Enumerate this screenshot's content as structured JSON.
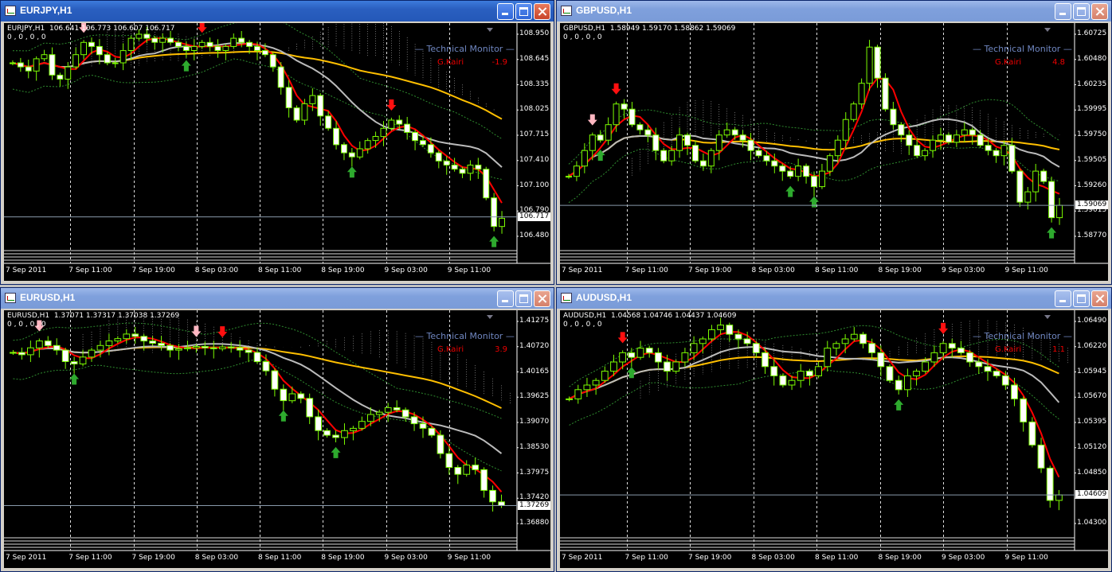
{
  "panels": [
    {
      "title": "EURJPY,H1",
      "header": "EURJPY,H1  106.641 106.773 106.607 106.717",
      "header2": "0 , 0 , 0 , 0",
      "tm_title": "Technical  Monitor",
      "tm_label": "G.Kairi",
      "tm_value": "-1.9",
      "y_ticks": [
        "108.950",
        "108.645",
        "108.335",
        "108.025",
        "107.715",
        "107.410",
        "107.100",
        "106.790",
        "106.480"
      ],
      "price_tag": "106.717",
      "x_ticks": [
        "7 Sep 2011",
        "7 Sep 11:00",
        "7 Sep 19:00",
        "8 Sep 03:00",
        "8 Sep 11:00",
        "8 Sep 19:00",
        "9 Sep 03:00",
        "9 Sep 11:00"
      ]
    },
    {
      "title": "GBPUSD,H1",
      "header": "GBPUSD,H1  1.58949 1.59170 1.58862 1.59069",
      "header2": "0 , 0 , 0 , 0",
      "tm_title": "Technical  Monitor",
      "tm_label": "G.Kairi",
      "tm_value": "4.8",
      "y_ticks": [
        "1.60725",
        "1.60480",
        "1.60235",
        "1.59995",
        "1.59750",
        "1.59505",
        "1.59260",
        "1.59015",
        "1.58770"
      ],
      "price_tag": "1.59069",
      "x_ticks": [
        "7 Sep 2011",
        "7 Sep 11:00",
        "7 Sep 19:00",
        "8 Sep 03:00",
        "8 Sep 11:00",
        "8 Sep 19:00",
        "9 Sep 03:00",
        "9 Sep 11:00"
      ]
    },
    {
      "title": "EURUSD,H1",
      "header": "EURUSD,H1  1.37071 1.37317 1.37038 1.37269",
      "header2": "0 , 0 , 0 , 0",
      "tm_title": "Technical  Monitor",
      "tm_label": "G.Kairi",
      "tm_value": "3.9",
      "y_ticks": [
        "1.41275",
        "1.40720",
        "1.40165",
        "1.39625",
        "1.39070",
        "1.38530",
        "1.37975",
        "1.37420",
        "1.36880"
      ],
      "price_tag": "1.37269",
      "x_ticks": [
        "7 Sep 2011",
        "7 Sep 11:00",
        "7 Sep 19:00",
        "8 Sep 03:00",
        "8 Sep 11:00",
        "8 Sep 19:00",
        "9 Sep 03:00",
        "9 Sep 11:00"
      ]
    },
    {
      "title": "AUDUSD,H1",
      "header": "AUDUSD,H1  1.04568 1.04746 1.04437 1.04609",
      "header2": "0 , 0 , 0 , 0",
      "tm_title": "Technical  Monitor",
      "tm_label": "G.Kairi",
      "tm_value": "1.1",
      "y_ticks": [
        "1.06490",
        "1.06220",
        "1.05945",
        "1.05670",
        "1.05395",
        "1.05120",
        "1.04850",
        "1.04575",
        "1.04300"
      ],
      "price_tag": "1.04609",
      "x_ticks": [
        "7 Sep 2011",
        "7 Sep 11:00",
        "7 Sep 19:00",
        "8 Sep 03:00",
        "8 Sep 11:00",
        "8 Sep 19:00",
        "9 Sep 03:00",
        "9 Sep 11:00"
      ]
    }
  ],
  "colors": {
    "bull": "#7CFC00",
    "bear": "#ffffff",
    "ma_fast": "#ff0000",
    "ma_mid": "#bbbbbb",
    "ma_slow": "#ffbf00",
    "bands": "#2e8b2e",
    "cloud": "#bbbbbb",
    "arrow_up": "#2eaa2e",
    "arrow_down_light": "#ffb6c1",
    "arrow_down_strong": "#ff1010"
  },
  "chart_data": [
    {
      "type": "candlestick",
      "symbol": "EURJPY",
      "timeframe": "H1",
      "ylim": [
        106.48,
        108.95
      ],
      "last": 106.717,
      "closes": [
        108.6,
        108.55,
        108.5,
        108.65,
        108.7,
        108.45,
        108.4,
        108.55,
        108.7,
        108.85,
        108.8,
        108.7,
        108.6,
        108.6,
        108.75,
        108.9,
        108.95,
        108.9,
        108.85,
        108.9,
        108.85,
        108.8,
        108.75,
        108.8,
        108.85,
        108.8,
        108.75,
        108.8,
        108.9,
        108.85,
        108.8,
        108.75,
        108.7,
        108.55,
        108.3,
        108.05,
        107.9,
        108.1,
        108.2,
        107.95,
        107.8,
        107.6,
        107.5,
        107.45,
        107.55,
        107.65,
        107.7,
        107.8,
        107.9,
        107.85,
        107.75,
        107.65,
        107.6,
        107.5,
        107.4,
        107.35,
        107.3,
        107.25,
        107.35,
        107.3,
        106.95,
        106.6,
        106.7
      ]
    },
    {
      "type": "candlestick",
      "symbol": "GBPUSD",
      "timeframe": "H1",
      "ylim": [
        1.5877,
        1.60725
      ],
      "last": 1.59069,
      "closes": [
        1.5935,
        1.5945,
        1.596,
        1.5975,
        1.597,
        1.5985,
        1.6005,
        1.6,
        1.5985,
        1.598,
        1.5975,
        1.596,
        1.595,
        1.596,
        1.5975,
        1.5965,
        1.595,
        1.5945,
        1.596,
        1.5975,
        1.598,
        1.5975,
        1.597,
        1.596,
        1.5955,
        1.595,
        1.5945,
        1.594,
        1.5935,
        1.5945,
        1.5935,
        1.5925,
        1.594,
        1.5955,
        1.597,
        1.599,
        1.6005,
        1.6025,
        1.606,
        1.603,
        1.6,
        1.5985,
        1.5975,
        1.5965,
        1.5955,
        1.596,
        1.597,
        1.5975,
        1.5968,
        1.5975,
        1.598,
        1.5975,
        1.5965,
        1.596,
        1.5955,
        1.5965,
        1.594,
        1.591,
        1.592,
        1.594,
        1.593,
        1.5895,
        1.5907
      ]
    },
    {
      "type": "candlestick",
      "symbol": "EURUSD",
      "timeframe": "H1",
      "ylim": [
        1.3688,
        1.41275
      ],
      "last": 1.37269,
      "closes": [
        1.406,
        1.4055,
        1.407,
        1.4085,
        1.4075,
        1.4065,
        1.404,
        1.4035,
        1.405,
        1.4065,
        1.4075,
        1.4085,
        1.409,
        1.41,
        1.4095,
        1.4085,
        1.408,
        1.4075,
        1.4065,
        1.4068,
        1.407,
        1.4073,
        1.407,
        1.4068,
        1.4072,
        1.407,
        1.4065,
        1.406,
        1.404,
        1.402,
        1.398,
        1.3955,
        1.397,
        1.396,
        1.392,
        1.389,
        1.388,
        1.3875,
        1.389,
        1.3895,
        1.391,
        1.3925,
        1.393,
        1.394,
        1.3935,
        1.392,
        1.3905,
        1.3895,
        1.388,
        1.384,
        1.381,
        1.3795,
        1.3815,
        1.3805,
        1.376,
        1.3735,
        1.3727
      ]
    },
    {
      "type": "candlestick",
      "symbol": "AUDUSD",
      "timeframe": "H1",
      "ylim": [
        1.043,
        1.0649
      ],
      "last": 1.04609,
      "closes": [
        1.0565,
        1.0575,
        1.058,
        1.0585,
        1.0595,
        1.0605,
        1.0615,
        1.061,
        1.062,
        1.0615,
        1.0605,
        1.0595,
        1.0605,
        1.0615,
        1.0625,
        1.063,
        1.064,
        1.0645,
        1.0635,
        1.063,
        1.0625,
        1.0615,
        1.06,
        1.059,
        1.058,
        1.0585,
        1.0595,
        1.059,
        1.06,
        1.062,
        1.0625,
        1.063,
        1.0635,
        1.0625,
        1.0615,
        1.06,
        1.0585,
        1.0575,
        1.059,
        1.0595,
        1.0605,
        1.0615,
        1.0625,
        1.062,
        1.0615,
        1.0605,
        1.06,
        1.0595,
        1.059,
        1.058,
        1.0565,
        1.054,
        1.0515,
        1.049,
        1.0455,
        1.0461
      ]
    }
  ]
}
